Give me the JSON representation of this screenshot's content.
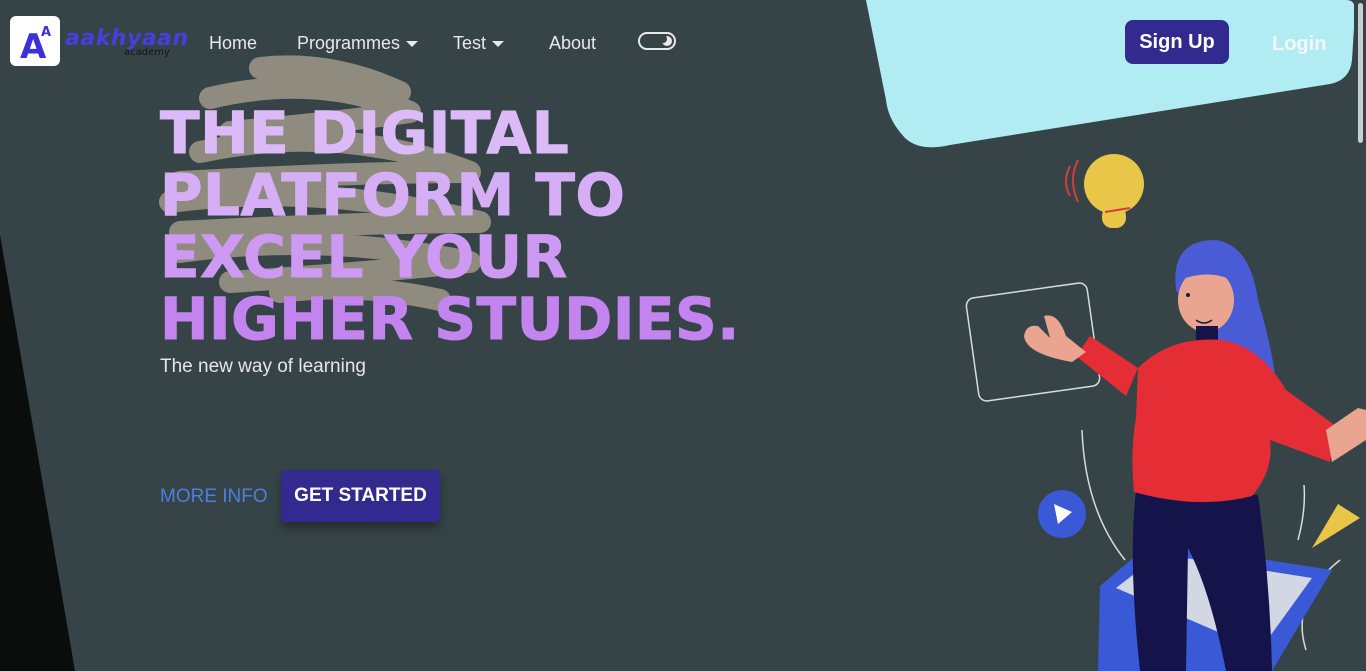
{
  "brand": {
    "logo_letter": "A",
    "logo_superscript": "A",
    "name": "aakhyaan",
    "subtitle": "academy"
  },
  "nav": {
    "items": [
      {
        "label": "Home",
        "dropdown": false
      },
      {
        "label": "Programmes",
        "dropdown": true
      },
      {
        "label": "Test",
        "dropdown": true
      },
      {
        "label": "About",
        "dropdown": false
      }
    ],
    "theme_toggle": "dark-mode-toggle-icon"
  },
  "auth": {
    "signup_label": "Sign Up",
    "login_label": "Login"
  },
  "hero": {
    "headline_lines": [
      "THE DIGITAL",
      "PLATFORM TO",
      "EXCEL YOUR",
      "HIGHER STUDIES."
    ],
    "subhead": "The new way of learning",
    "more_info_label": "MORE INFO",
    "get_started_label": "GET STARTED"
  },
  "colors": {
    "background": "#364447",
    "accent": "#322a8e",
    "headline": "#c98af0",
    "link": "#4a7fe0",
    "cyan_shape": "#b0ecf2"
  }
}
